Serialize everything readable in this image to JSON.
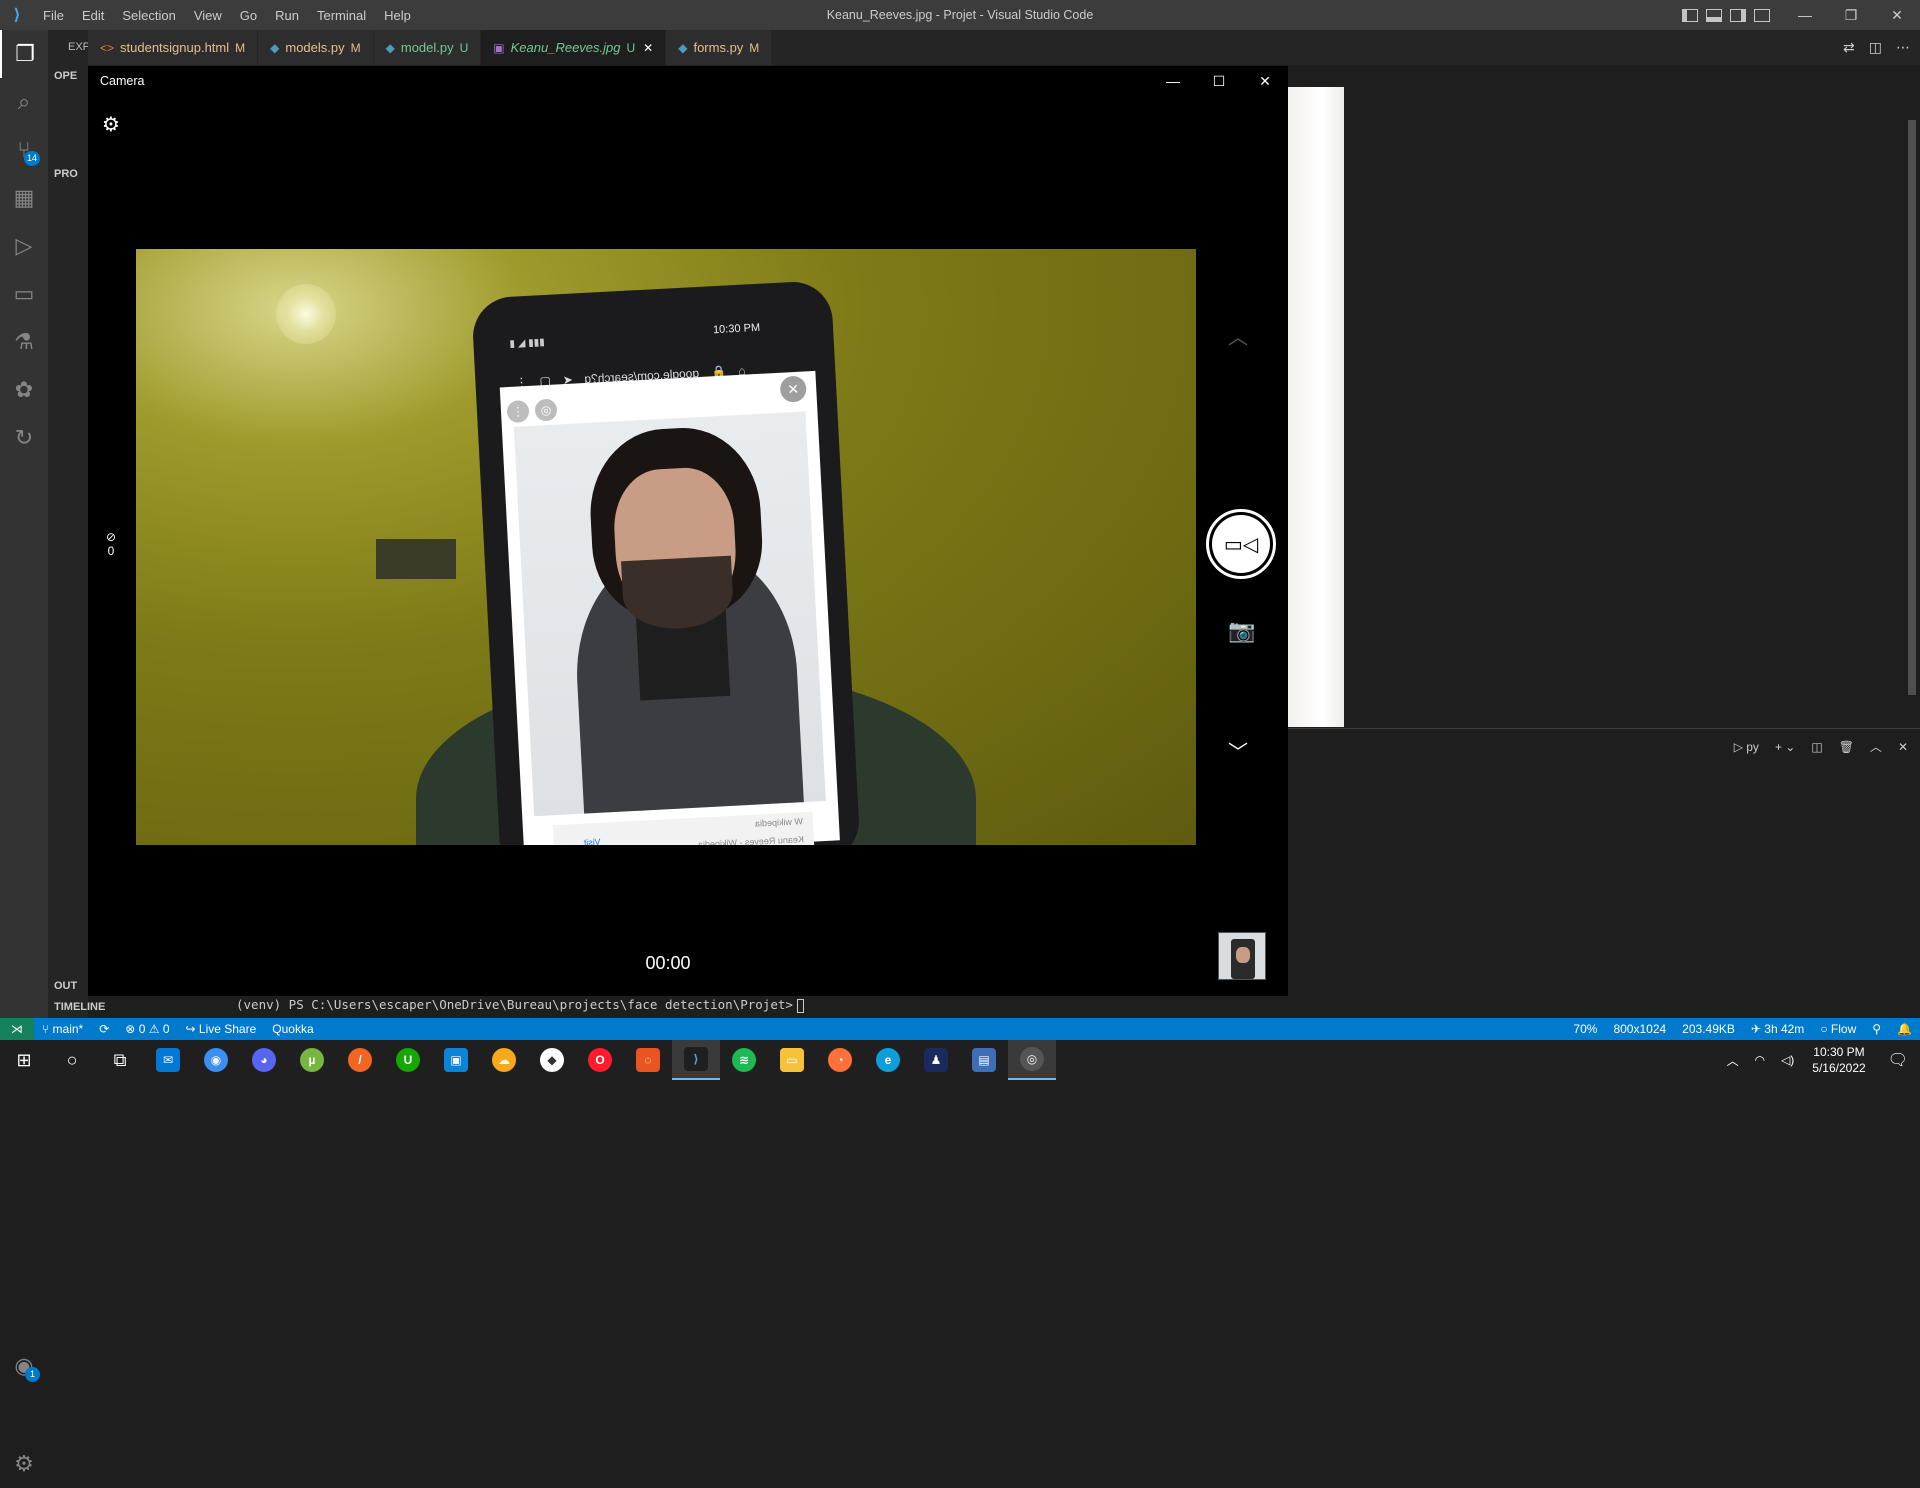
{
  "window": {
    "title": "Keanu_Reeves.jpg - Projet - Visual Studio Code",
    "menu": [
      "File",
      "Edit",
      "Selection",
      "View",
      "Go",
      "Run",
      "Terminal",
      "Help"
    ]
  },
  "activity_bar": {
    "source_control_badge": "14",
    "accounts_badge": "1"
  },
  "sidebar": {
    "header": "EXPLORER",
    "open_editors": "OPE",
    "project": "PRO",
    "outline": "OUT",
    "timeline": "TIMELINE"
  },
  "tabs": [
    {
      "icon": "<>",
      "label": "studentsignup.html",
      "status": "M"
    },
    {
      "icon": "◆",
      "label": "models.py",
      "status": "M"
    },
    {
      "icon": "◆",
      "label": "model.py",
      "status": "U"
    },
    {
      "icon": "▣",
      "label": "Keanu_Reeves.jpg",
      "status": "U"
    },
    {
      "icon": "◆",
      "label": "forms.py",
      "status": "M"
    }
  ],
  "camera": {
    "title": "Camera",
    "timer_count": "0",
    "elapsed": "00:00",
    "phone": {
      "status_time": "10:30 PM",
      "url": "google.com/search?q",
      "caption": "Keanu Reeves - Wikipedia",
      "visit": "Visit",
      "source": "W wikipedia"
    }
  },
  "panel": {
    "terminal_shell": "py"
  },
  "terminal": {
    "line": "(venv) PS C:\\Users\\escaper\\OneDrive\\Bureau\\projects\\face detection\\Projet>"
  },
  "statusbar": {
    "branch": "main*",
    "errors": "0",
    "warnings": "0",
    "live_share": "Live Share",
    "quokka": "Quokka",
    "zoom": "70%",
    "dimensions": "800x1024",
    "filesize": "203.49KB",
    "time_spent": "3h 42m",
    "flow": "Flow"
  },
  "taskbar": {
    "time": "10:30 PM",
    "date": "5/16/2022"
  }
}
